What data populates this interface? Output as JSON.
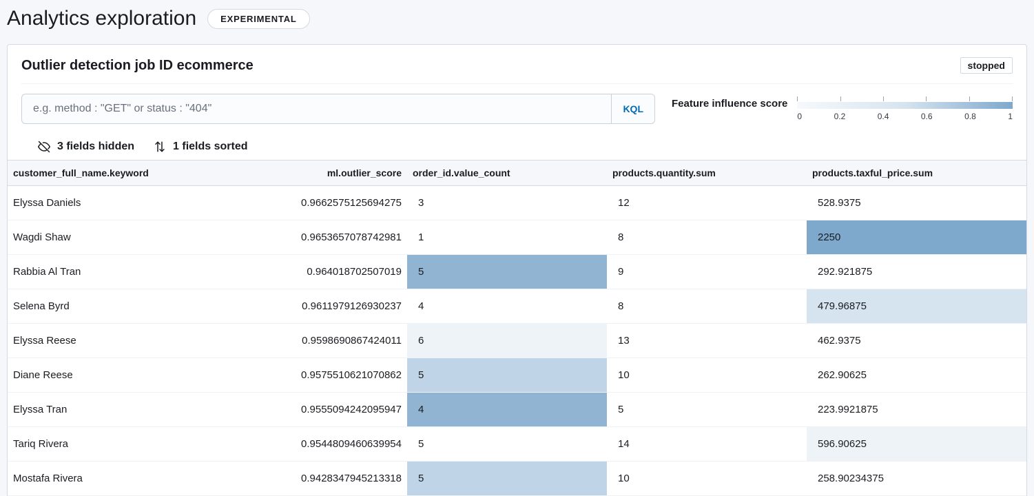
{
  "header": {
    "title": "Analytics exploration",
    "badge": "EXPERIMENTAL"
  },
  "panel": {
    "title": "Outlier detection job ID ecommerce",
    "status": "stopped"
  },
  "search": {
    "placeholder": "e.g. method : \"GET\" or status : \"404\"",
    "kql_label": "KQL"
  },
  "legend": {
    "label": "Feature influence score",
    "ticks": [
      "0",
      "0.2",
      "0.4",
      "0.6",
      "0.8",
      "1"
    ]
  },
  "toolbar": {
    "hidden_fields": "3 fields hidden",
    "sorted_fields": "1 fields sorted"
  },
  "columns": {
    "c0": "customer_full_name.keyword",
    "c1": "ml.outlier_score",
    "c2": "order_id.value_count",
    "c3": "products.quantity.sum",
    "c4": "products.taxful_price.sum"
  },
  "heat_colors": {
    "none": "#ffffff",
    "faint": "#eef3f8",
    "light": "#d6e4ef",
    "mlight": "#bfd5e7",
    "med": "#a9c6df",
    "strong": "#90b4d2",
    "stronger": "#7ea8cc"
  },
  "rows": [
    {
      "name": "Elyssa Daniels",
      "score": "0.9662575125694275",
      "order": "3",
      "order_heat": "none",
      "qty": "12",
      "qty_heat": "none",
      "price": "528.9375",
      "price_heat": "none"
    },
    {
      "name": "Wagdi Shaw",
      "score": "0.9653657078742981",
      "order": "1",
      "order_heat": "none",
      "qty": "8",
      "qty_heat": "none",
      "price": "2250",
      "price_heat": "stronger"
    },
    {
      "name": "Rabbia Al Tran",
      "score": "0.964018702507019",
      "order": "5",
      "order_heat": "strong",
      "qty": "9",
      "qty_heat": "none",
      "price": "292.921875",
      "price_heat": "none"
    },
    {
      "name": "Selena Byrd",
      "score": "0.9611979126930237",
      "order": "4",
      "order_heat": "none",
      "qty": "8",
      "qty_heat": "none",
      "price": "479.96875",
      "price_heat": "light"
    },
    {
      "name": "Elyssa Reese",
      "score": "0.9598690867424011",
      "order": "6",
      "order_heat": "faint",
      "qty": "13",
      "qty_heat": "none",
      "price": "462.9375",
      "price_heat": "none"
    },
    {
      "name": "Diane Reese",
      "score": "0.9575510621070862",
      "order": "5",
      "order_heat": "mlight",
      "qty": "10",
      "qty_heat": "none",
      "price": "262.90625",
      "price_heat": "none"
    },
    {
      "name": "Elyssa Tran",
      "score": "0.9555094242095947",
      "order": "4",
      "order_heat": "strong",
      "qty": "5",
      "qty_heat": "none",
      "price": "223.9921875",
      "price_heat": "none"
    },
    {
      "name": "Tariq Rivera",
      "score": "0.9544809460639954",
      "order": "5",
      "order_heat": "none",
      "qty": "14",
      "qty_heat": "none",
      "price": "596.90625",
      "price_heat": "faint"
    },
    {
      "name": "Mostafa Rivera",
      "score": "0.9428347945213318",
      "order": "5",
      "order_heat": "mlight",
      "qty": "10",
      "qty_heat": "none",
      "price": "258.90234375",
      "price_heat": "none"
    }
  ]
}
